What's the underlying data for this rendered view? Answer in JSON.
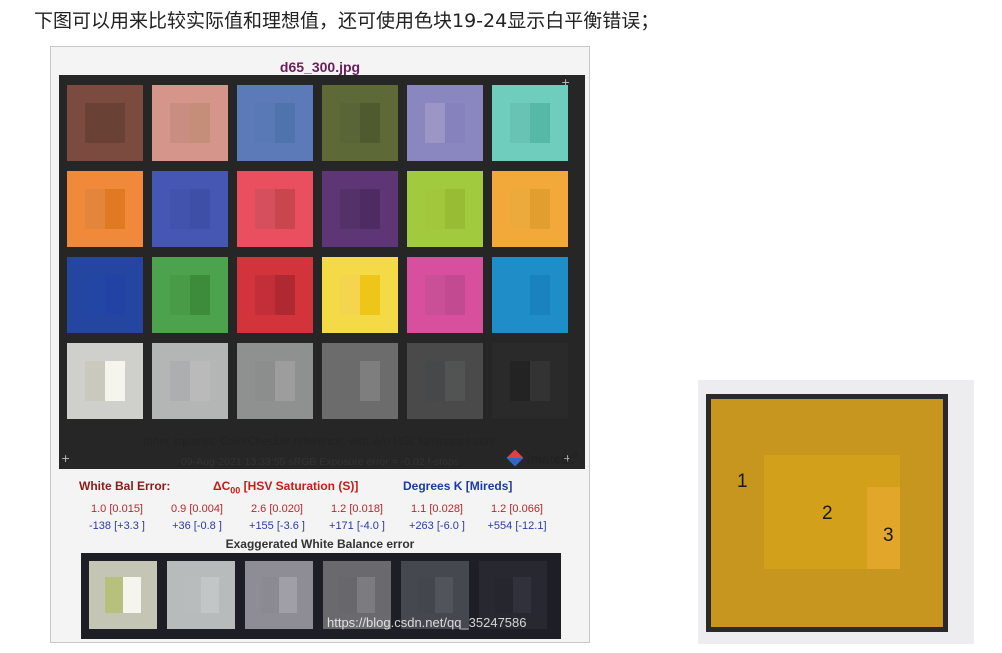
{
  "caption": "下图可以用来比较实际值和理想值，还可使用色块19-24显示白平衡错误；",
  "figure": {
    "title": "d65_300.jpg",
    "note_line1": "Inner squares: ColorChecker reference: with,w/o HSL luminance corr.",
    "note_line2": "09-Aug-2021 13:33:55    sRGB    Exposure error = -0.02 f-stops",
    "logo": "imatest",
    "logo_mark": "®",
    "wb_label": "White Bal Error:",
    "delta_label": "ΔC",
    "delta_sub": "00",
    "hsv_label": "[HSV Saturation (S)]",
    "degrees_label": "Degrees K [Mireds]",
    "row1": [
      "1.0 [0.015]",
      "0.9 [0.004]",
      "2.6 [0.020]",
      "1.2 [0.018]",
      "1.1 [0.028]",
      "1.2 [0.066]"
    ],
    "row2": [
      "-138 [+3.3 ]",
      "+36 [-0.8 ]",
      "+155 [-3.6 ]",
      "+171 [-4.0 ]",
      "+263 [-6.0 ]",
      "+554 [-12.1]"
    ],
    "exag_title": "Exaggerated White Balance error",
    "watermark": "https://blog.csdn.net/qq_35247586",
    "colors": {
      "title": "#6a1f5c",
      "wb_label": "#8b1a1a",
      "hsv": "#cc1a1a",
      "degrees": "#1a3aa8",
      "row1": "#c0262d",
      "row2": "#2a3aa8"
    },
    "patches": [
      [
        "#7a4b3e",
        "#6a4235",
        "#6a4135"
      ],
      [
        "#d5958a",
        "#c98d82",
        "#c48e78"
      ],
      [
        "#5b7ab7",
        "#5879b6",
        "#4f73ad"
      ],
      [
        "#5d6a37",
        "#5a6537",
        "#4f5a2f"
      ],
      [
        "#8a86bf",
        "#9b96c6",
        "#8682be"
      ],
      [
        "#6fcdbe",
        "#69c3b4",
        "#56b9a8"
      ],
      [
        "#f08a3a",
        "#e3863c",
        "#e07a22"
      ],
      [
        "#4556b3",
        "#4253ad",
        "#3e4fa7"
      ],
      [
        "#e94f5e",
        "#d5505c",
        "#c9464f"
      ],
      [
        "#5e3575",
        "#55316a",
        "#4e2c63"
      ],
      [
        "#a2ca3f",
        "#a2c63c",
        "#98bd35"
      ],
      [
        "#f3a83a",
        "#ebaa3b",
        "#e29e2e"
      ],
      [
        "#2546a0",
        "#2345a3",
        "#2242a5"
      ],
      [
        "#4ca24d",
        "#489c48",
        "#3c8c3c"
      ],
      [
        "#d3343c",
        "#c32f38",
        "#b02831"
      ],
      [
        "#f5da47",
        "#f5d54d",
        "#eec61a"
      ],
      [
        "#d84f9e",
        "#c94f97",
        "#c24a91"
      ],
      [
        "#1f8ec8",
        "#1f8ec8",
        "#1a83bf"
      ],
      [
        "#cfd0cb",
        "#c9c9bd",
        "#f5f5ee"
      ],
      [
        "#b4b5b5",
        "#adaeaf",
        "#bababa"
      ],
      [
        "#8f9090",
        "#8c8d8d",
        "#9d9d9d"
      ],
      [
        "#6c6c6c",
        "#6b6b6b",
        "#7e7e7e"
      ],
      [
        "#4a4a4b",
        "#474849",
        "#525353"
      ],
      [
        "#2a2a2a",
        "#232323",
        "#333333"
      ]
    ],
    "strip_patches": [
      [
        "#c4c5b4",
        "#b8c07e",
        "#f5f5ee"
      ],
      [
        "#b7bbbb",
        "#b8bcbd",
        "#c2c6c7"
      ],
      [
        "#8e8d96",
        "#8b8a93",
        "#a09fa8"
      ],
      [
        "#6a6a6e",
        "#68686c",
        "#7c7c80"
      ],
      [
        "#464850",
        "#44464e",
        "#52545c"
      ],
      [
        "#272830",
        "#25262e",
        "#30313a"
      ]
    ]
  },
  "detail": {
    "label1": "1",
    "label2": "2",
    "label3": "3"
  }
}
